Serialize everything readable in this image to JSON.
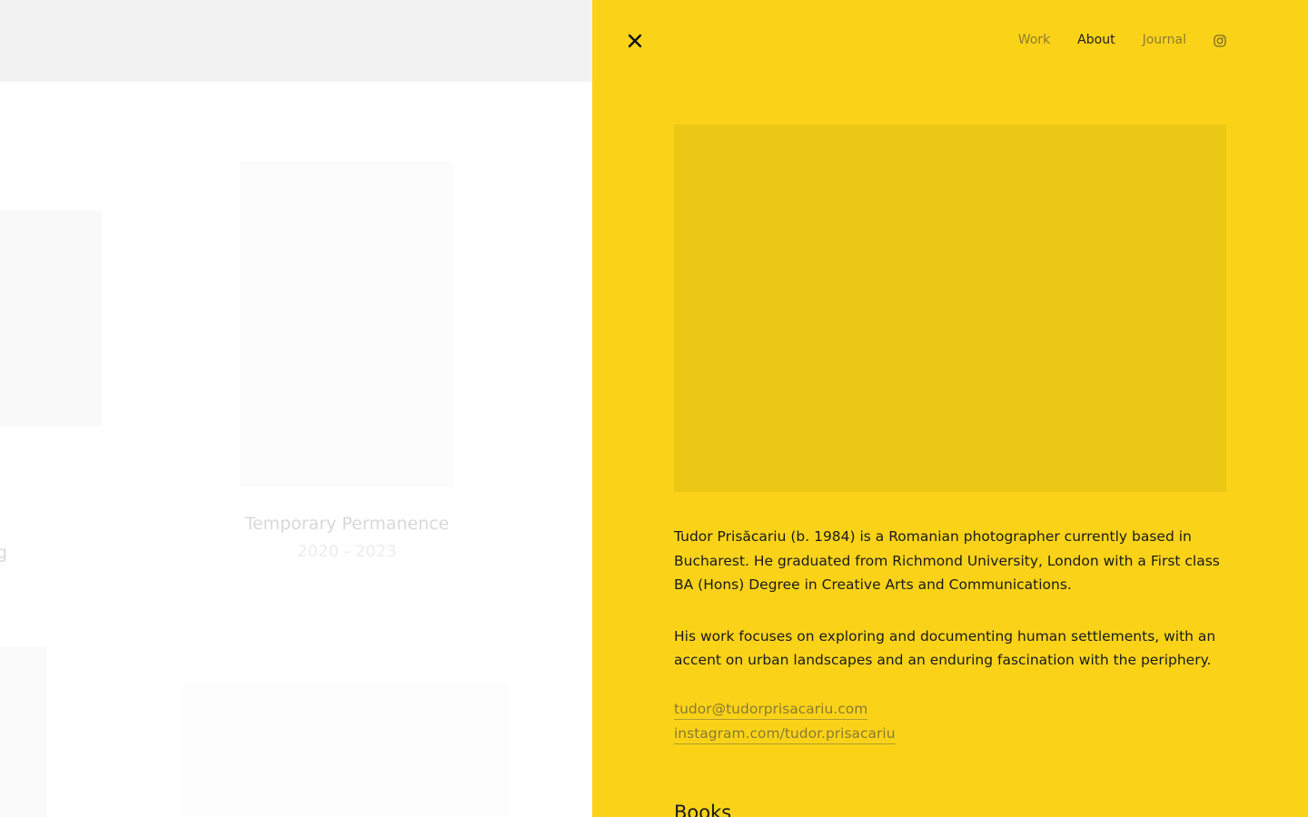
{
  "gallery": {
    "project_title": "Temporary Permanence",
    "project_years": "2020 - 2023",
    "partial_label": "g"
  },
  "panel": {
    "nav": {
      "work": "Work",
      "about": "About",
      "journal": "Journal",
      "instagram_icon": "instagram-icon",
      "close_icon": "close-icon"
    },
    "bio": {
      "paragraph1": "Tudor Prisăcariu (b. 1984) is a Romanian photographer currently based in Bucharest. He graduated from Richmond University, London with a First class BA (Hons) Degree in Creative Arts and Communications.",
      "paragraph2": "His work focuses on exploring and documenting human settlements, with an accent on urban landscapes and an enduring fascination with the periphery."
    },
    "links": {
      "email": "tudor@tudorprisacariu.com",
      "instagram": "instagram.com/tudor.prisacariu"
    },
    "books_heading": "Books"
  },
  "colors": {
    "panel_bg": "#fad319",
    "photo_placeholder": "#ebc815",
    "text": "#1a1a1a",
    "muted_nav": "#8f7c2c"
  }
}
